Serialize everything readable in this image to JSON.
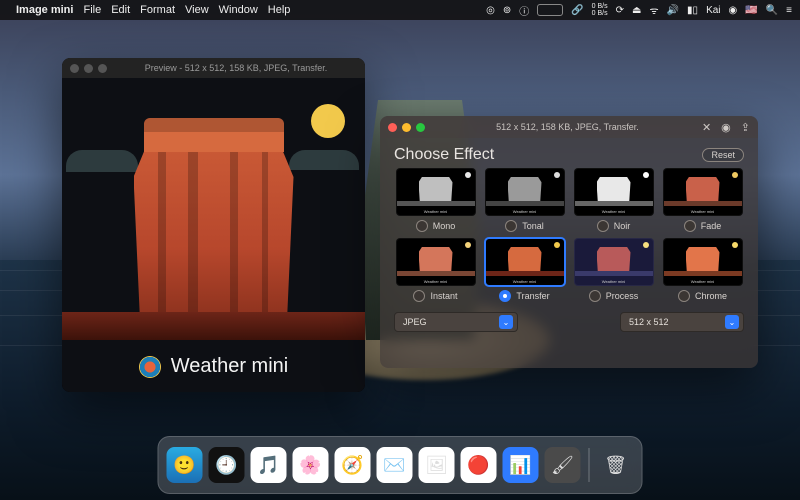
{
  "menubar": {
    "app": "Image mini",
    "items": [
      "File",
      "Edit",
      "Format",
      "View",
      "Window",
      "Help"
    ],
    "right": {
      "user": "Kai",
      "flag": "🇺🇸"
    }
  },
  "preview": {
    "title": "Preview - 512 x 512, 158 KB, JPEG, Transfer.",
    "caption": "Weather mini"
  },
  "panel": {
    "title": "512 x 512, 158 KB, JPEG, Transfer.",
    "heading": "Choose Effect",
    "reset": "Reset",
    "effects": [
      {
        "name": "Mono",
        "butte": "#bfbfbf",
        "moon": "#e8e8e8",
        "ground": "#555"
      },
      {
        "name": "Tonal",
        "butte": "#9a9a9a",
        "moon": "#dcdcdc",
        "ground": "#444"
      },
      {
        "name": "Noir",
        "butte": "#e8e8e8",
        "moon": "#fff",
        "ground": "#666"
      },
      {
        "name": "Fade",
        "butte": "#c9614a",
        "moon": "#efc861",
        "ground": "#6b3a2a"
      },
      {
        "name": "Instant",
        "butte": "#d4765b",
        "moon": "#f3d27a",
        "ground": "#7a4634"
      },
      {
        "name": "Transfer",
        "butte": "#d66a3f",
        "moon": "#f2c94c",
        "ground": "#6d2518",
        "selected": true
      },
      {
        "name": "Process",
        "butte": "#b85a5a",
        "moon": "#f6df80",
        "ground": "#3a3a6a",
        "sky": "#1a1a3a"
      },
      {
        "name": "Chrome",
        "butte": "#e2754a",
        "moon": "#f7d96a",
        "ground": "#7c3a22"
      }
    ],
    "format": {
      "label": "JPEG"
    },
    "size": {
      "label": "512 x 512"
    }
  },
  "dock": {
    "items": [
      {
        "name": "finder",
        "bg": "linear-gradient(#29abe2,#1b6fb5)",
        "glyph": "🙂"
      },
      {
        "name": "clock",
        "bg": "#111",
        "glyph": "🕘"
      },
      {
        "name": "music",
        "bg": "#fff",
        "glyph": "🎵"
      },
      {
        "name": "photos",
        "bg": "#fff",
        "glyph": "🌸"
      },
      {
        "name": "safari",
        "bg": "#fff",
        "glyph": "🧭"
      },
      {
        "name": "mail",
        "bg": "#fff",
        "glyph": "✉️"
      },
      {
        "name": "preview",
        "bg": "#fff",
        "glyph": "🖼"
      },
      {
        "name": "record",
        "bg": "#fff",
        "glyph": "🔴"
      },
      {
        "name": "equalizer",
        "bg": "#2f7bff",
        "glyph": "📊"
      },
      {
        "name": "image-mini",
        "bg": "#4a4a4a",
        "glyph": "🖌"
      }
    ],
    "trash": "🗑"
  }
}
